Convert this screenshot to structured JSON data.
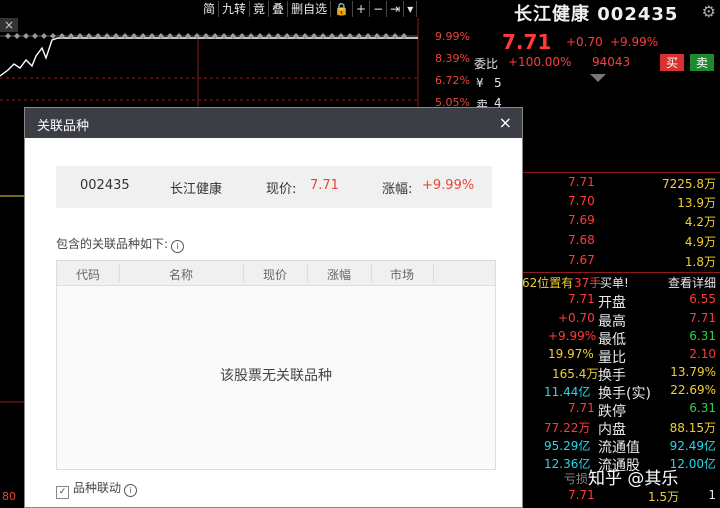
{
  "toolbar": {
    "items": [
      "简",
      "九转",
      "竟",
      "叠",
      "删自选",
      "🔒",
      "+",
      "−",
      "⇥",
      "▾"
    ]
  },
  "chart": {
    "close_label": "×",
    "pct_labels": [
      "9.99%",
      "8.39%",
      "6.72%",
      "5.05%"
    ],
    "bottom_label": "80",
    "colors": {
      "up": "#e8473b",
      "line": "#ffffff",
      "grid": "#8b1a1a"
    }
  },
  "quote": {
    "name_code": "长江健康 002435",
    "price": "7.71",
    "change": "+0.70",
    "change_pct": "+9.99%",
    "weibi_label": "委比",
    "weibi_value": "+100.00%",
    "weibi_volume": "94043",
    "buy_label": "买",
    "sell_label": "卖",
    "ask_rows": [
      {
        "label": "¥",
        "value": "5"
      },
      {
        "label": "卖",
        "value": "4"
      }
    ],
    "bid_rows": [
      {
        "price": "7.71",
        "volume": "7225.8万"
      },
      {
        "price": "7.70",
        "volume": "13.9万"
      },
      {
        "price": "7.69",
        "volume": "4.2万"
      },
      {
        "price": "7.68",
        "volume": "4.9万"
      },
      {
        "price": "7.67",
        "volume": "1.8万"
      }
    ],
    "alert_prefix": "62位置有",
    "alert_hands": "37手",
    "alert_action": "买单!",
    "alert_link": "查看详细",
    "stats": [
      {
        "lv": "7.71",
        "lc": "red",
        "label": "开盘",
        "rv": "6.55",
        "rc": "red"
      },
      {
        "lv": "+0.70",
        "lc": "red",
        "label": "最高",
        "rv": "7.71",
        "rc": "red"
      },
      {
        "lv": "+9.99%",
        "lc": "red",
        "label": "最低",
        "rv": "6.31",
        "rc": "grn"
      },
      {
        "lv": "19.97%",
        "lc": "yel",
        "label": "量比",
        "rv": "2.10",
        "rc": "red"
      },
      {
        "lv": "165.4万",
        "lc": "yel",
        "label": "换手",
        "rv": "13.79%",
        "rc": "yel"
      },
      {
        "lv": "11.44亿",
        "lc": "cyan",
        "label": "换手(实)",
        "rv": "22.69%",
        "rc": "yel"
      },
      {
        "lv": "7.71",
        "lc": "red",
        "label": "跌停",
        "rv": "6.31",
        "rc": "grn"
      },
      {
        "lv": "77.22万",
        "lc": "red",
        "label": "内盘",
        "rv": "88.15万",
        "rc": "yel"
      },
      {
        "lv": "95.29亿",
        "lc": "cyan",
        "label": "流通值",
        "rv": "92.49亿",
        "rc": "cyan"
      },
      {
        "lv": "12.36亿",
        "lc": "cyan",
        "label": "流通股",
        "rv": "12.00亿",
        "rc": "cyan"
      }
    ],
    "partial_label": "亏损",
    "last_row": {
      "price": "7.71",
      "volume": "1.5万",
      "extra": "1"
    }
  },
  "modal": {
    "title": "关联品种",
    "close": "×",
    "code": "002435",
    "name": "长江健康",
    "price_label": "现价:",
    "price": "7.71",
    "pct_label": "涨幅:",
    "pct": "+9.99%",
    "related_label": "包含的关联品种如下:",
    "columns": [
      "代码",
      "名称",
      "现价",
      "涨幅",
      "市场"
    ],
    "empty_msg": "该股票无关联品种",
    "linkage_label": "品种联动",
    "checkbox_mark": "✓"
  },
  "watermark": "知乎 @其乐"
}
